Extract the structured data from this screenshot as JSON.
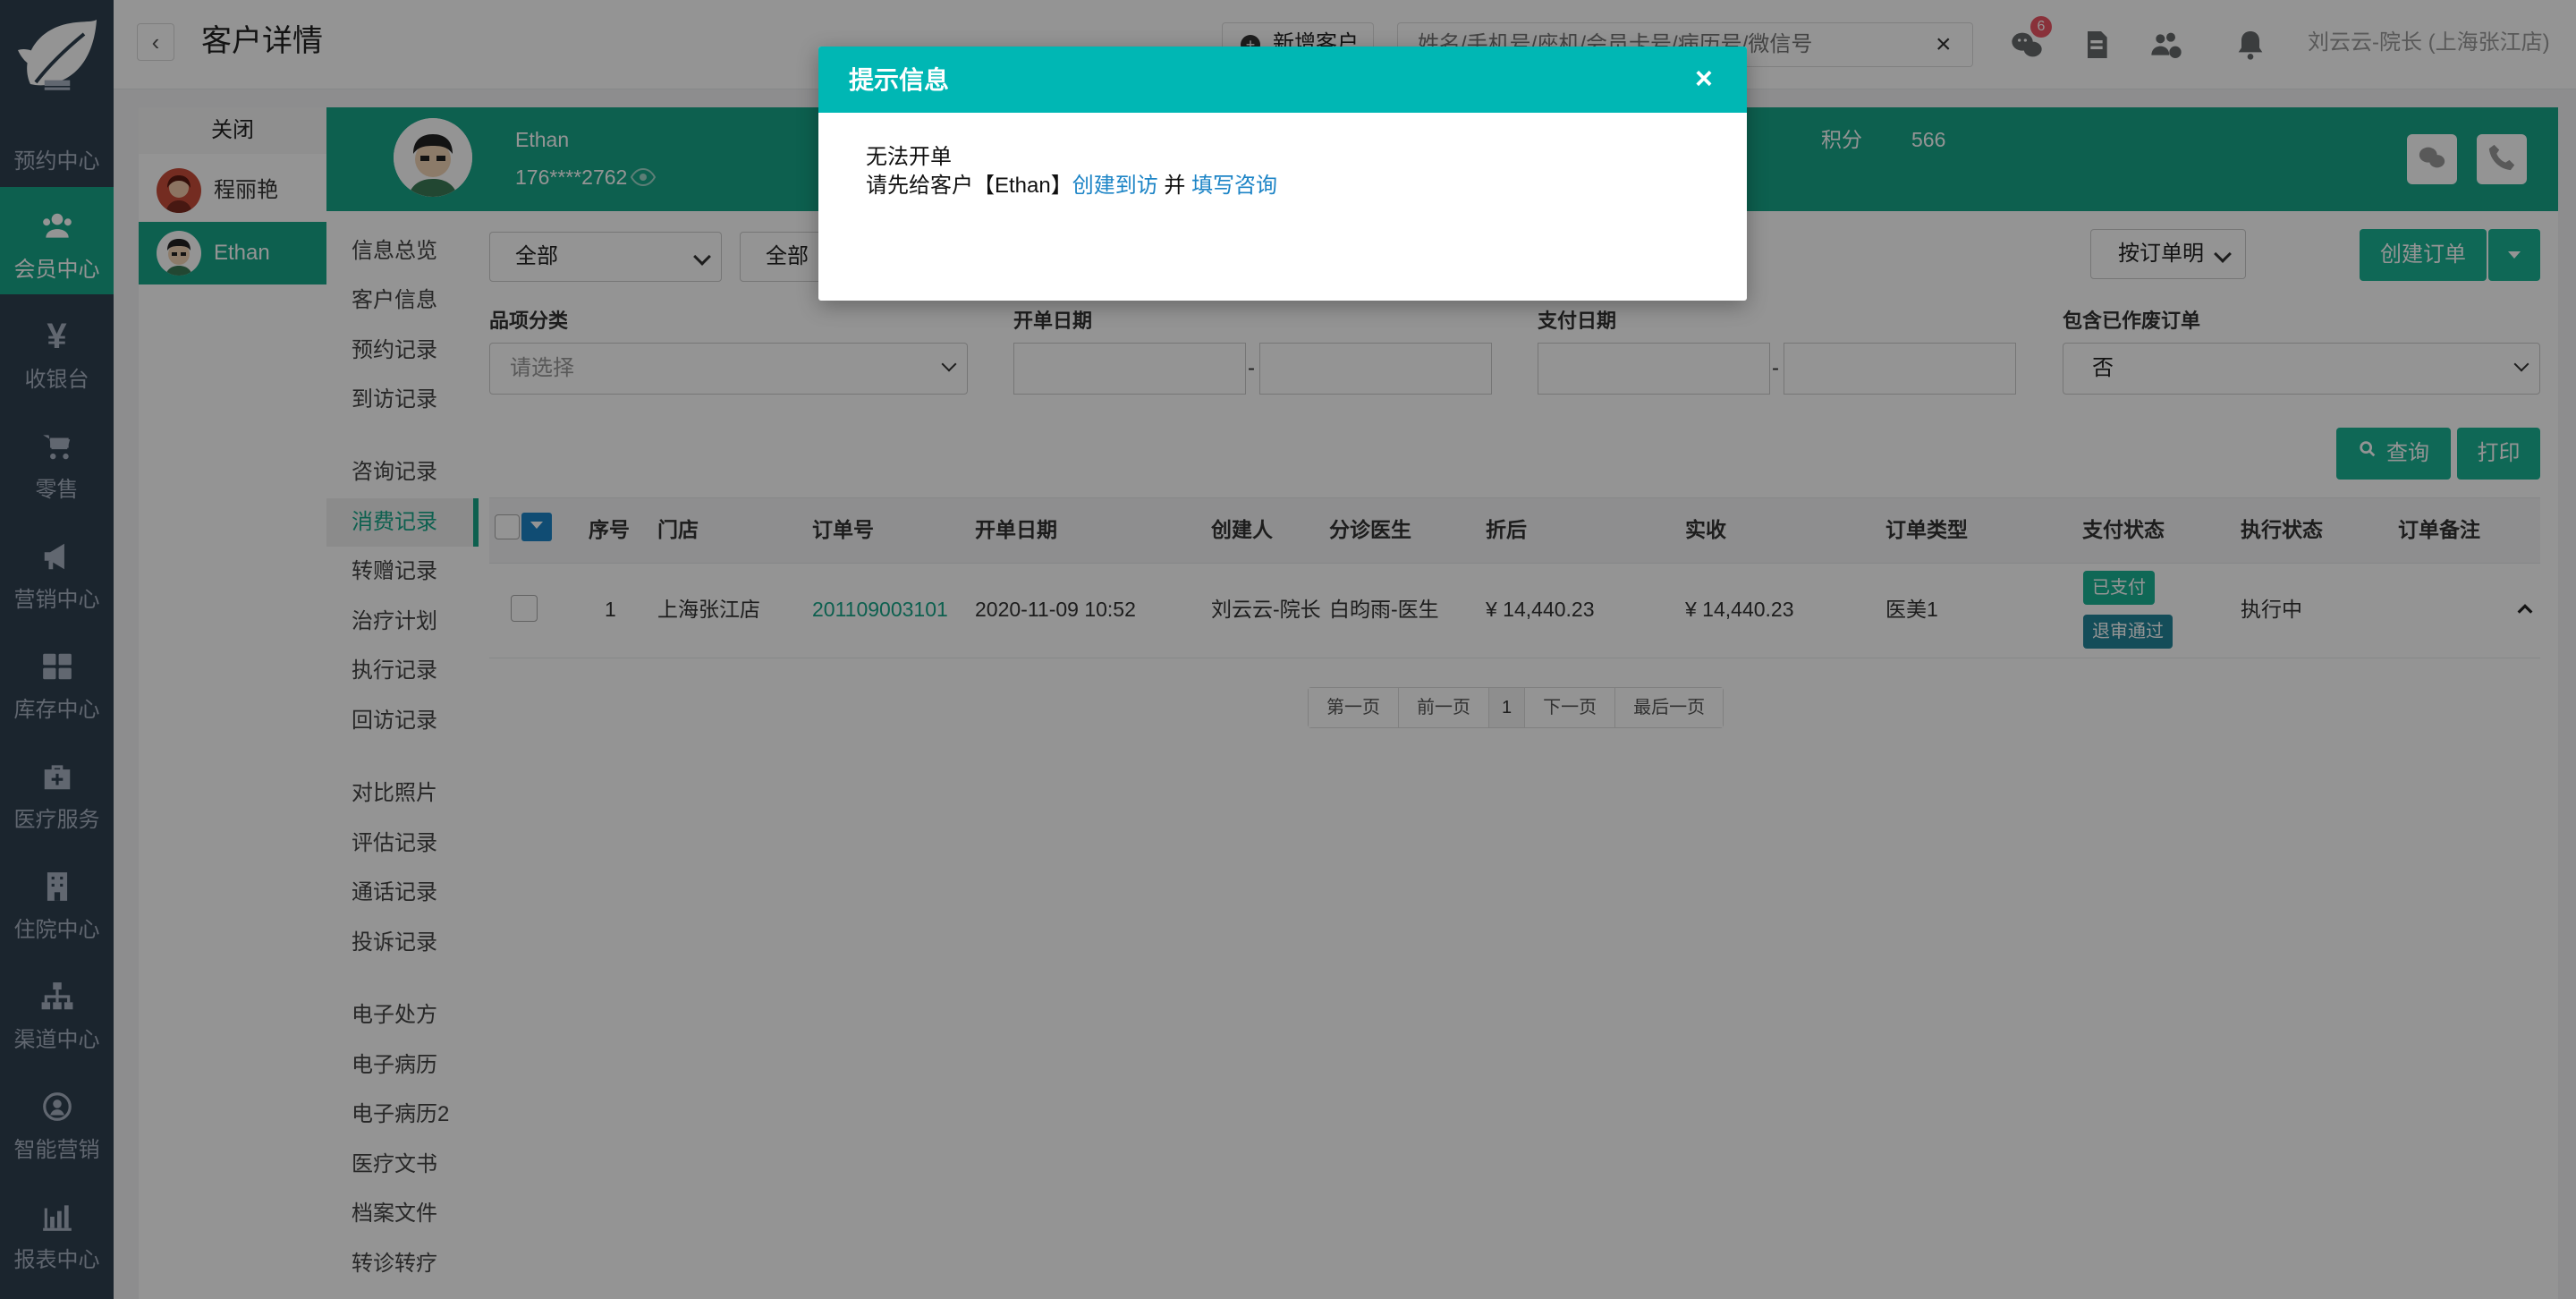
{
  "sidebar": {
    "items": [
      {
        "label": "预约中心",
        "icon": "calendar-icon"
      },
      {
        "label": "会员中心",
        "icon": "users-icon",
        "active": true
      },
      {
        "label": "收银台",
        "icon": "yen-icon"
      },
      {
        "label": "零售",
        "icon": "cart-icon"
      },
      {
        "label": "营销中心",
        "icon": "megaphone-icon"
      },
      {
        "label": "库存中心",
        "icon": "grid-icon"
      },
      {
        "label": "医疗服务",
        "icon": "medkit-icon"
      },
      {
        "label": "住院中心",
        "icon": "building-icon"
      },
      {
        "label": "渠道中心",
        "icon": "sitemap-icon"
      },
      {
        "label": "智能营销",
        "icon": "smart-marketing-icon"
      },
      {
        "label": "报表中心",
        "icon": "bar-chart-icon"
      }
    ]
  },
  "header": {
    "title": "客户详情",
    "new_customer": "新增客户",
    "search_placeholder": "姓名/手机号/座机/会员卡号/病历号/微信号",
    "message_badge": "6",
    "user": "刘云云-院长 (上海张江店)"
  },
  "customer_tabs": {
    "close_label": "关闭",
    "items": [
      {
        "name": "程丽艳"
      },
      {
        "name": "Ethan",
        "active": true
      }
    ]
  },
  "customer": {
    "name": "Ethan",
    "phone": "176****2762",
    "points_label": "积分",
    "points": "566"
  },
  "sub_nav": {
    "items": [
      "信息总览",
      "客户信息",
      "预约记录",
      "到访记录",
      "咨询记录",
      "消费记录",
      "转赠记录",
      "治疗计划",
      "执行记录",
      "回访记录",
      "对比照片",
      "评估记录",
      "通话记录",
      "投诉记录",
      "电子处方",
      "电子病历",
      "电子病历2",
      "医疗文书",
      "档案文件",
      "转诊转疗"
    ],
    "active": "消费记录"
  },
  "filters": {
    "select_all_1": "全部",
    "select_all_2": "全部",
    "order_view": "按订单明",
    "create_order": "创建订单",
    "category_label": "品项分类",
    "category_placeholder": "请选择",
    "open_date_label": "开单日期",
    "pay_date_label": "支付日期",
    "include_void_label": "包含已作废订单",
    "include_void_value": "否",
    "range_sep": "-",
    "query": "查询",
    "print": "打印"
  },
  "table": {
    "headers": [
      "序号",
      "门店",
      "订单号",
      "开单日期",
      "创建人",
      "分诊医生",
      "折后",
      "实收",
      "订单类型",
      "支付状态",
      "执行状态",
      "订单备注"
    ],
    "rows": [
      {
        "index": "1",
        "store": "上海张江店",
        "order_no": "201109003101",
        "date": "2020-11-09 10:52",
        "creator": "刘云云-院长",
        "doctor": "白昀雨-医生",
        "discounted": "¥ 14,440.23",
        "received": "¥ 14,440.23",
        "type": "医美1",
        "pay_status": "已支付",
        "refund_status": "退审通过",
        "exec_status": "执行中"
      }
    ]
  },
  "pagination": {
    "first": "第一页",
    "prev": "前一页",
    "current": "1",
    "next": "下一页",
    "last": "最后一页"
  },
  "modal": {
    "title": "提示信息",
    "close": "×",
    "line1": "无法开单",
    "line2_prefix": "请先给客户【Ethan】",
    "link1": "创建到访",
    "conj": " 并 ",
    "link2": "填写咨询"
  },
  "colors": {
    "sidebar": "#2f4050",
    "accent": "#18a689",
    "modal_header": "#00b7b4",
    "link": "#1c84c6"
  }
}
